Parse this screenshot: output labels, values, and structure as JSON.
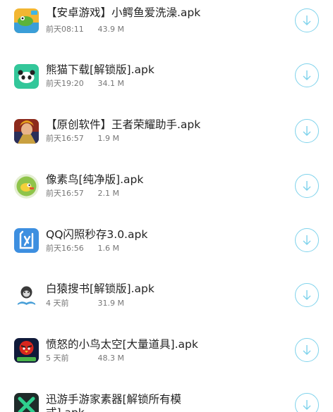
{
  "accent_color": "#7fd3ec",
  "items": [
    {
      "title": "【安卓游戏】小鳄鱼爱洗澡.apk",
      "date": "前天08:11",
      "size": "43.9 M",
      "icon": "crocodile-game-icon"
    },
    {
      "title": "熊猫下载[解锁版].apk",
      "date": "前天19:20",
      "size": "34.1 M",
      "icon": "panda-icon"
    },
    {
      "title": "【原创软件】王者荣耀助手.apk",
      "date": "前天16:57",
      "size": "1.9 M",
      "icon": "hero-portrait-icon"
    },
    {
      "title": "像素鸟[纯净版].apk",
      "date": "前天16:57",
      "size": "2.1 M",
      "icon": "pixel-bird-icon"
    },
    {
      "title": "QQ闪照秒存3.0.apk",
      "date": "前天16:56",
      "size": "1.6 M",
      "icon": "flash-character-icon"
    },
    {
      "title": "白猿搜书[解锁版].apk",
      "date": "4 天前",
      "size": "31.9 M",
      "icon": "ape-reading-icon"
    },
    {
      "title": "愤怒的小鸟太空[大量道具].apk",
      "date": "5 天前",
      "size": "48.3 M",
      "icon": "angry-bird-space-icon"
    },
    {
      "title": "迅游手游家素器[解锁所有模式].apk",
      "date": "",
      "size": "",
      "icon": "xunyou-x-icon"
    }
  ]
}
